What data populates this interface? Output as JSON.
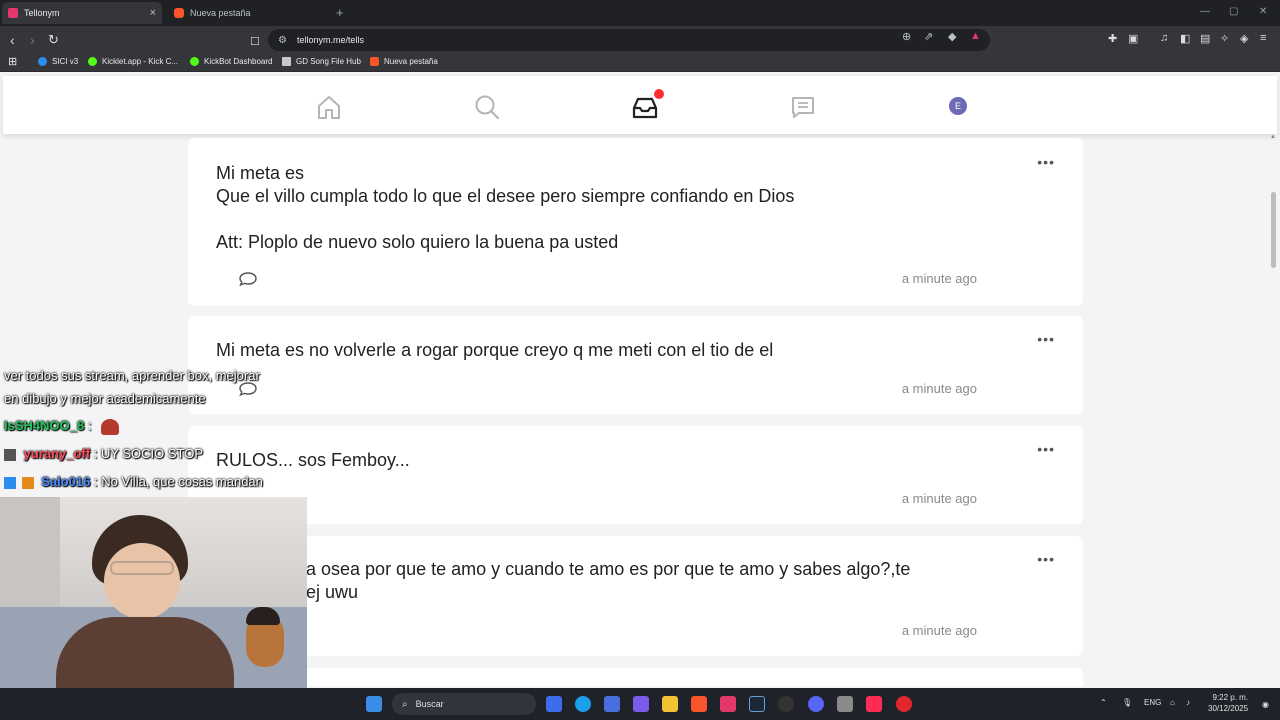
{
  "browser": {
    "tabs": [
      {
        "title": "Tellonym",
        "active": true
      },
      {
        "title": "Nueva pestaña",
        "active": false
      }
    ],
    "url": "tellonym.me/tells",
    "bookmarks": [
      "SICI v3",
      "Kicklet.app - Kick C...",
      "KickBot Dashboard",
      "GD Song File Hub",
      "Nueva pestaña"
    ]
  },
  "app_nav": {
    "items": [
      "home-icon",
      "search-icon",
      "inbox-icon",
      "messages-icon"
    ],
    "active": "inbox-icon",
    "inbox_has_notification": true,
    "avatar_letter": "E",
    "avatar_color": "#6d6ab7"
  },
  "tells": [
    {
      "text": "Mi meta es\nQue el villo cumpla todo lo que el desee pero siempre confiando en Dios\n\nAtt: Ploplo de nuevo solo quiero la buena pa usted",
      "time": "a minute ago"
    },
    {
      "text": "Mi meta es no volverle a rogar porque creyo q me meti con el tio de el",
      "time": "a minute ago"
    },
    {
      "text": "RULOS... sos Femboy...",
      "time": "a minute ago"
    },
    {
      "text": "a osea por que te amo y cuando te amo es por que te amo y sabes algo?,te\nej uwu",
      "time": "a minute ago"
    }
  ],
  "stream_chat": [
    {
      "user": "",
      "message": "ver todos sus stream, aprender box, mejorar"
    },
    {
      "user": "",
      "message": "en dibujo y mejor academicamente"
    },
    {
      "user": "IsSH4NOO_8",
      "message": ":",
      "color": "#22c55e"
    },
    {
      "user": "yurany_off",
      "message": ": UY SOCIO STOP",
      "color": "#ff4d5e"
    },
    {
      "user": "Salo016",
      "message": ": No Villa, que cosas mandan",
      "color": "#4a8bff"
    }
  ],
  "taskbar": {
    "search_placeholder": "Buscar",
    "language": "ENG",
    "time": "9:22 p. m.",
    "date": "30/12/2025"
  }
}
